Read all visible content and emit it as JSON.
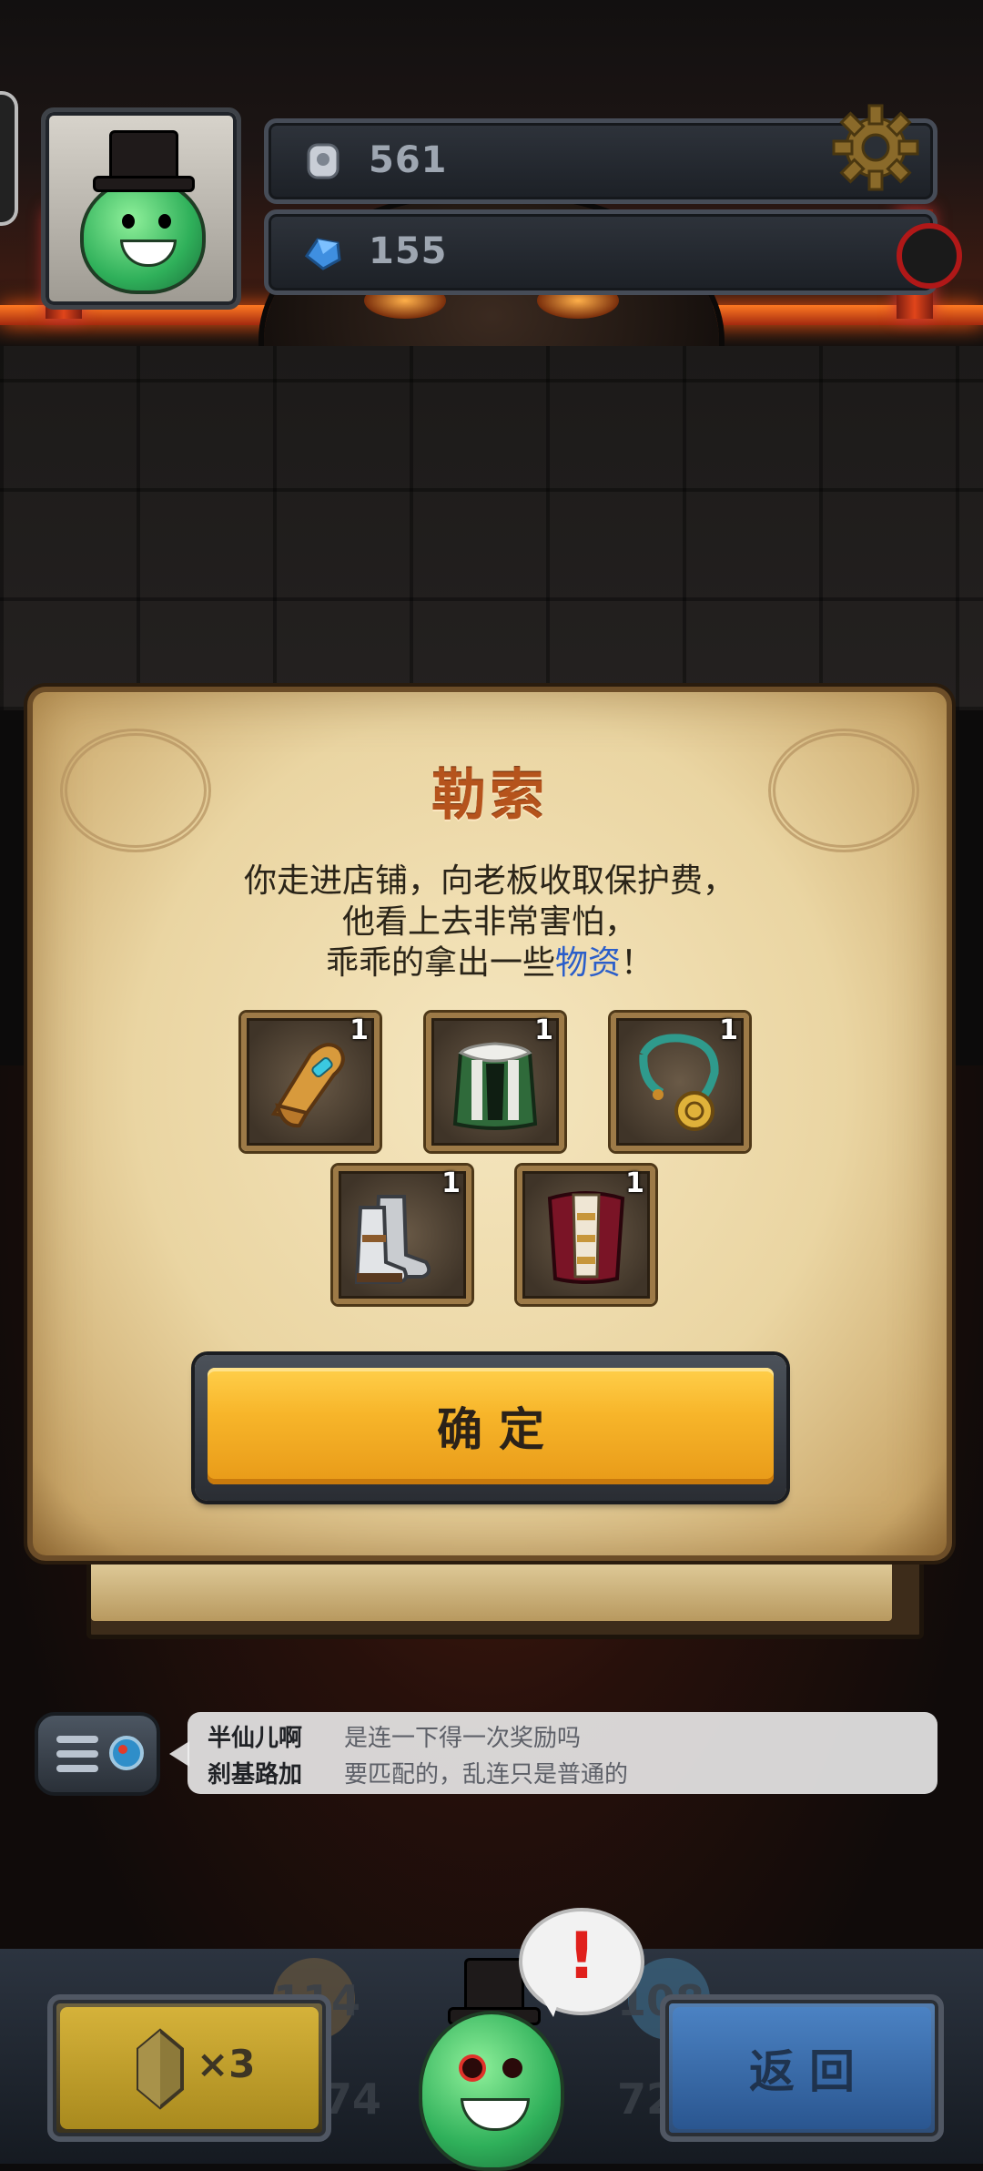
{
  "hud": {
    "resource_1": {
      "icon": "stone-tablet-icon",
      "value": "561"
    },
    "resource_2": {
      "icon": "blue-gem-icon",
      "value": "155"
    },
    "settings_icon": "gear-icon"
  },
  "dialog": {
    "title": "勒索",
    "body_line_1": "你走进店铺，向老板收取保护费，",
    "body_line_2": "他看上去非常害怕，",
    "body_line_3_prefix": "乖乖的拿出一些",
    "body_line_3_highlight": "物资",
    "body_line_3_suffix": "！",
    "items": [
      {
        "name": "golden-gauntlet",
        "count": "1"
      },
      {
        "name": "green-fur-cloak",
        "count": "1"
      },
      {
        "name": "coin-necklace",
        "count": "1"
      },
      {
        "name": "iron-boots",
        "count": "1"
      },
      {
        "name": "red-armor",
        "count": "1"
      }
    ],
    "confirm_label": "确定"
  },
  "chat": {
    "messages": [
      {
        "user": "半仙儿啊",
        "text": "是连一下得一次奖励吗"
      },
      {
        "user": "刹基路加",
        "text": "要匹配的，乱连只是普通的"
      }
    ]
  },
  "bottom_bar": {
    "potion_count": "×3",
    "back_label": "返回",
    "stats": [
      "114",
      "74",
      "108",
      "72"
    ],
    "alert_mark": "!"
  },
  "colors": {
    "title": "#b5531c",
    "highlight": "#2b5ec9",
    "confirm": "#f7b52a",
    "back": "#2a5690"
  }
}
